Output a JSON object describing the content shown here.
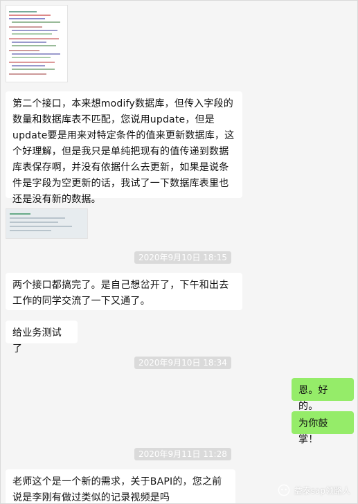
{
  "chat": {
    "messages": [
      {
        "text": "第二个接口，本来想modify数据库，但传入字段的数量和数据库表不匹配，您说用update，但是update要是用来对特定条件的值来更新数据库，这个好理解，但是我只是单纯把现有的值传递到数据库表保存啊，并没有依据什么去更新，如果是说条件是字段为空更新的话，我试了一下数据库表里也还是没有新的数据。"
      },
      {
        "text": "两个接口都搞完了。是自己想岔开了，下午和出去工作的同学交流了一下又通了。"
      },
      {
        "text": "给业务测试了"
      },
      {
        "text": "恩。好的。"
      },
      {
        "text": "为你鼓掌！"
      },
      {
        "text": "老师这个是一个新的需求，关于BAPI的，您之前说是李刚有做过类似的记录视频是吗"
      }
    ],
    "timestamps": [
      "2020年9月10日 18:15",
      "2020年9月10日 18:34",
      "2020年9月11日 11:28"
    ]
  },
  "watermark": {
    "text": "益泰sap领路人",
    "icon": "wechat-official-account-icon"
  },
  "colors": {
    "background": "#f5f5f5",
    "bubble_in": "#ffffff",
    "bubble_out": "#95ec69",
    "timestamp_bg": "#dadada"
  }
}
